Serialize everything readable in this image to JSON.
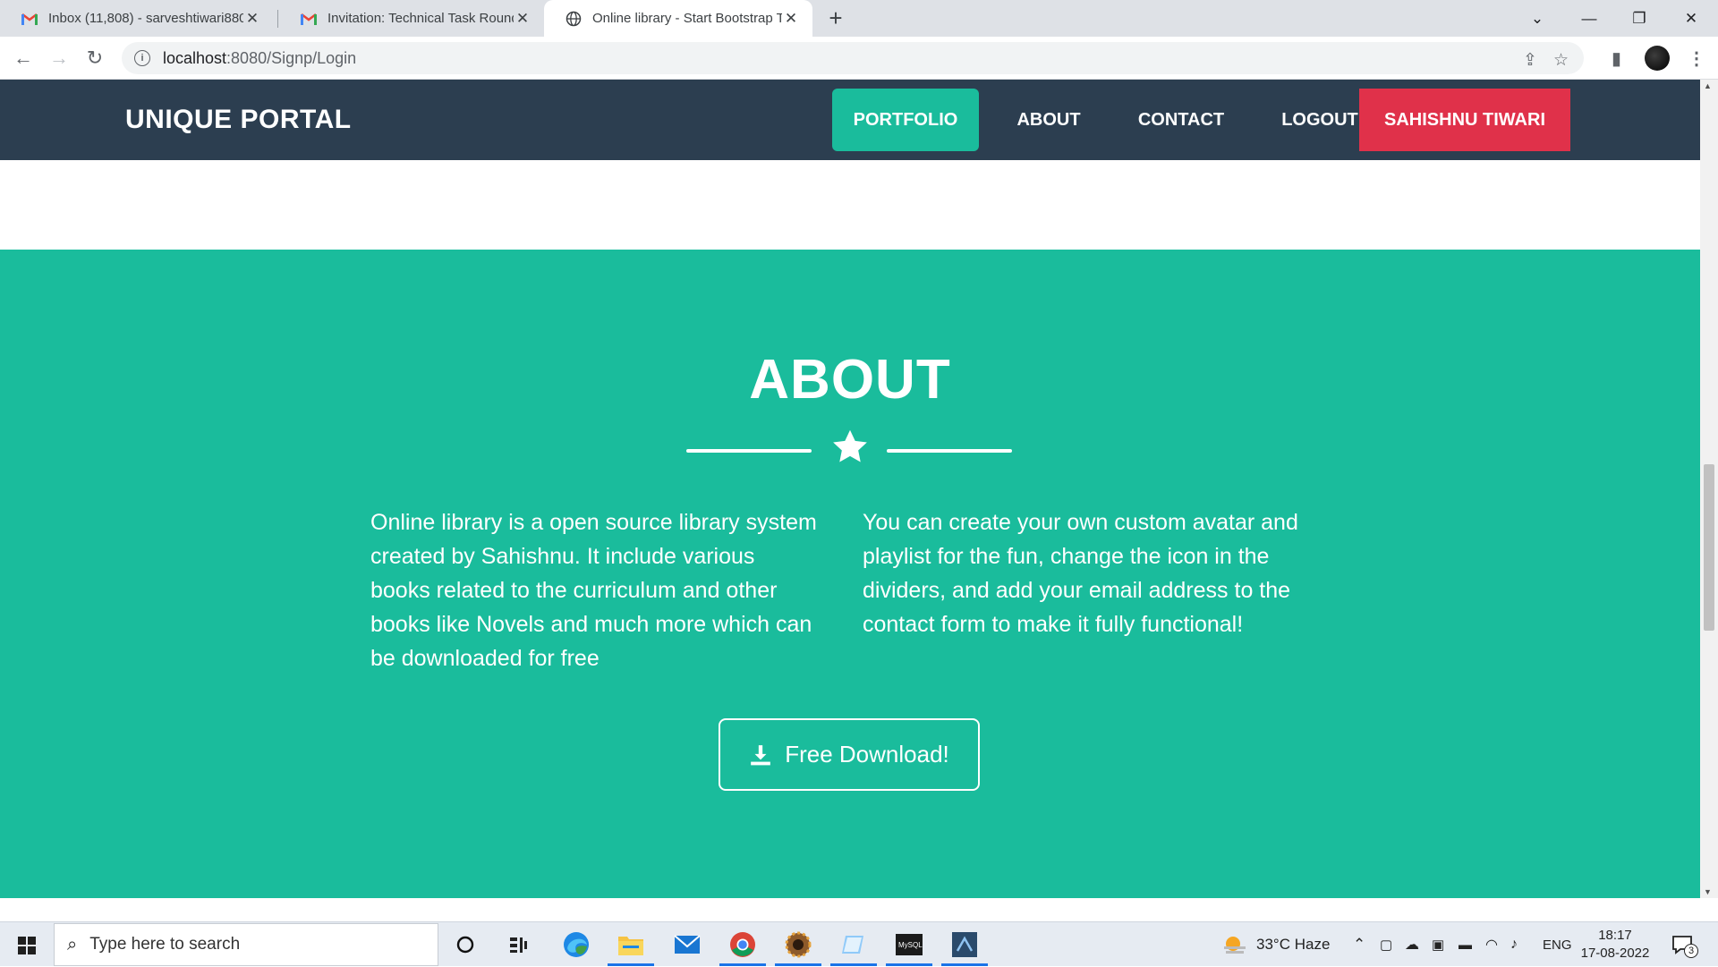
{
  "browser": {
    "tabs": [
      {
        "title": "Inbox (11,808) - sarveshtiwari880",
        "icon": "gmail-icon"
      },
      {
        "title": "Invitation: Technical Task Round |",
        "icon": "gmail-icon"
      },
      {
        "title": "Online library - Start Bootstrap Th",
        "icon": "globe-icon",
        "active": true
      }
    ],
    "url_host": "localhost",
    "url_rest": ":8080/Signp/Login"
  },
  "navbar": {
    "brand": "UNIQUE PORTAL",
    "links": [
      "PORTFOLIO",
      "ABOUT",
      "CONTACT",
      "LOGOUT"
    ],
    "user": "SAHISHNU TIWARI"
  },
  "about": {
    "title": "ABOUT",
    "left_text": "Online library is a open source library system created by Sahishnu. It include various books related to the curriculum and other books like Novels and much more which can be downloaded for free",
    "right_text": "You can create your own custom avatar and playlist for the fun, change the icon in the dividers, and add your email address to the contact form to make it fully functional!",
    "button": "Free Download!"
  },
  "colors": {
    "navbar": "#2c3e50",
    "accent": "#1abc9c",
    "user_button": "#e0314a"
  },
  "taskbar": {
    "search_placeholder": "Type here to search",
    "weather": "33°C  Haze",
    "language": "ENG",
    "time": "18:17",
    "date": "17-08-2022",
    "notifications": "3"
  }
}
